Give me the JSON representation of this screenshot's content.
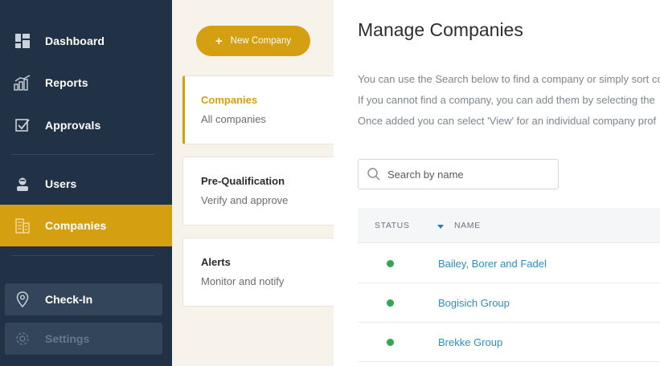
{
  "sidebar": {
    "items": [
      {
        "label": "Dashboard",
        "icon": "dashboard-icon"
      },
      {
        "label": "Reports",
        "icon": "reports-icon"
      },
      {
        "label": "Approvals",
        "icon": "approvals-icon"
      },
      {
        "label": "Users",
        "icon": "user-icon"
      },
      {
        "label": "Companies",
        "icon": "companies-icon",
        "active": true
      }
    ],
    "bottom": [
      {
        "label": "Check-In",
        "icon": "location-pin-icon"
      },
      {
        "label": "Settings",
        "icon": "gear-icon",
        "disabled": true
      }
    ]
  },
  "panel": {
    "new_button_label": "New Company",
    "cards": [
      {
        "title": "Companies",
        "subtitle": "All companies",
        "active": true
      },
      {
        "title": "Pre-Qualification",
        "subtitle": "Verify and approve"
      },
      {
        "title": "Alerts",
        "subtitle": "Monitor and notify"
      }
    ]
  },
  "main": {
    "title": "Manage Companies",
    "description": [
      "You can use the Search below to find a company or simply sort co",
      "If you cannot find a company, you can add them by selecting the",
      "Once added you can select 'View' for an individual company prof"
    ],
    "search": {
      "placeholder": "Search by name"
    },
    "table": {
      "columns": [
        "STATUS",
        "NAME"
      ],
      "sort_column": "NAME",
      "rows": [
        {
          "status": "active",
          "name": "Bailey, Borer and Fadel"
        },
        {
          "status": "active",
          "name": "Bogisich Group"
        },
        {
          "status": "active",
          "name": "Brekke Group"
        }
      ]
    }
  },
  "colors": {
    "sidebar_bg": "#223246",
    "accent": "#d4a011",
    "panel_bg": "#f7f2ea",
    "link": "#2d8fbf",
    "status_active": "#2fa84f"
  }
}
